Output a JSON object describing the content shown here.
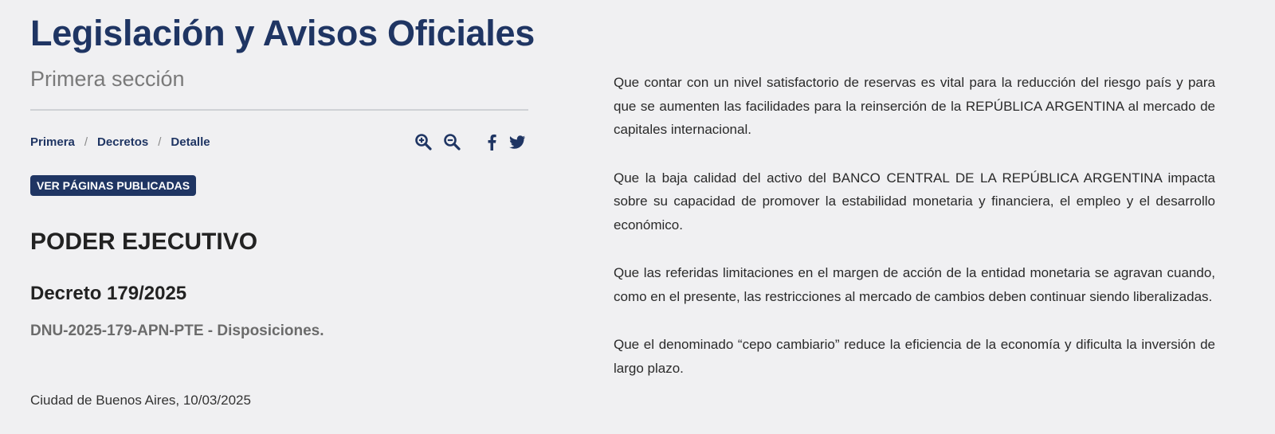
{
  "header": {
    "title": "Legislación y Avisos Oficiales",
    "section": "Primera sección"
  },
  "breadcrumb": {
    "items": [
      "Primera",
      "Decretos",
      "Detalle"
    ],
    "separator": "/"
  },
  "toolbar": {
    "icons": [
      "zoom-in-icon",
      "zoom-out-icon",
      "facebook-icon",
      "twitter-icon"
    ],
    "facebook_glyph": "f"
  },
  "badge": {
    "label": "VER PÁGINAS PUBLICADAS"
  },
  "document": {
    "branch": "PODER EJECUTIVO",
    "title": "Decreto 179/2025",
    "subtitle": "DNU-2025-179-APN-PTE - Disposiciones.",
    "place_date": "Ciudad de Buenos Aires, 10/03/2025",
    "paragraphs": [
      "Que contar con un nivel satisfactorio de reservas es vital para la reducción del riesgo país y para que se aumenten las facilidades para la reinserción de la REPÚBLICA ARGENTINA al mercado de capitales internacional.",
      "Que la baja calidad del activo del BANCO CENTRAL DE LA REPÚBLICA ARGENTINA impacta sobre su capacidad de promover la estabilidad monetaria y financiera, el empleo y el desarrollo económico.",
      "Que las referidas limitaciones en el margen de acción de la entidad monetaria se agravan cuando, como en el presente, las restricciones al mercado de cambios deben continuar siendo liberalizadas.",
      "Que el denominado “cepo cambiario” reduce la eficiencia de la economía y dificulta la inversión de largo plazo."
    ]
  },
  "colors": {
    "brand": "#1f3563",
    "background": "#f0f0f2",
    "muted": "#7a7a7a"
  }
}
